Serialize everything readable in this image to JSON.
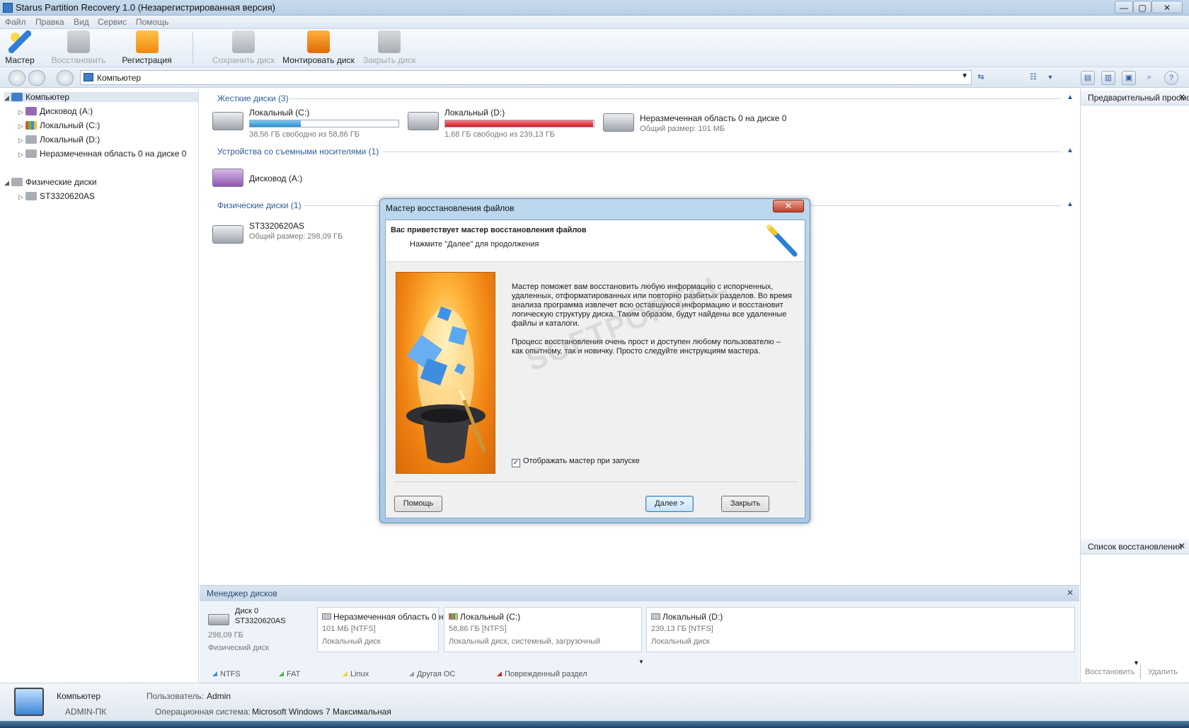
{
  "window": {
    "title": "Starus Partition Recovery 1.0 (Незарегистрированная версия)",
    "min": "—",
    "max": "▢",
    "close": "✕"
  },
  "menu": [
    "Файл",
    "Правка",
    "Вид",
    "Сервис",
    "Помощь"
  ],
  "toolbar": {
    "wizard": "Мастер",
    "restore": "Восстановить",
    "register": "Регистрация",
    "save_disk": "Сохранить диск",
    "mount_disk": "Монтировать диск",
    "close_disk": "Закрыть диск"
  },
  "address": {
    "path": "Компьютер"
  },
  "tree": {
    "computer": "Компьютер",
    "items": [
      "Дисковод (A:)",
      "Локальный (C:)",
      "Локальный (D:)",
      "Неразмеченная область 0 на диске 0"
    ],
    "physical": "Физические диски",
    "physical_items": [
      "ST3320620AS"
    ]
  },
  "main": {
    "hdd_header": "Жесткие диски (3)",
    "drive_c": {
      "name": "Локальный (C:)",
      "info": "38,56 ГБ свободно из 58,86 ГБ",
      "used": 0.345
    },
    "drive_d": {
      "name": "Локальный (D:)",
      "info": "1,68 ГБ свободно из 239,13 ГБ",
      "used": 0.993
    },
    "unalloc": {
      "name": "Неразмеченная область 0 на диске 0",
      "info": "Общий размер: 101 МБ"
    },
    "removable_header": "Устройства со съемными носителями (1)",
    "floppy": "Дисковод (A:)",
    "physical_header": "Физические диски (1)",
    "phys": {
      "name": "ST3320620AS",
      "info": "Общий размер: 298,09 ГБ"
    }
  },
  "right_panel": {
    "preview": "Предварительный просмотр",
    "restore_list": "Список восстановления",
    "restore_btn": "Восстановить",
    "delete_btn": "Удалить"
  },
  "disk_manager": {
    "title": "Менеджер дисков",
    "disk": {
      "name": "Диск 0",
      "model": "ST3320620AS",
      "size": "298,09 ГБ",
      "type": "Физический диск"
    },
    "parts": [
      {
        "name": "Неразмеченная область 0 н",
        "size": "101 МБ [NTFS]",
        "type": "Локальный диск"
      },
      {
        "name": "Локальный (C:)",
        "size": "58,86 ГБ [NTFS]",
        "type": "Локальный диск, системный, загрузочный"
      },
      {
        "name": "Локальный (D:)",
        "size": "239,13 ГБ [NTFS]",
        "type": "Локальный диск"
      }
    ],
    "legend": [
      "NTFS",
      "FAT",
      "Linux",
      "Другая ОС",
      "Поврежденный раздел"
    ]
  },
  "status": {
    "computer": "Компьютер",
    "pc_name": "ADMIN-ПК",
    "user_label": "Пользователь:",
    "user": "Admin",
    "os_label": "Операционная система:",
    "os": "Microsoft Windows 7 Максимальная"
  },
  "dialog": {
    "title": "Мастер восстановления файлов",
    "heading": "Вас приветствует мастер восстановления файлов",
    "subheading": "Нажмите \"Далее\" для продолжения",
    "para1": "Мастер поможет вам восстановить любую информацию с испорченных, удаленных, отформатированных или повторно разбитых разделов. Во время анализа программа извлечет всю оставшуюся информацию и восстановит логическую структуру диска. Таким образом, будут найдены все удаленные файлы и каталоги.",
    "para2": "Процесс восстановления очень прост и доступен любому пользователю – как опытному, так и новичку. Просто следуйте инструкциям мастера.",
    "checkbox": "Отображать мастер при запуске",
    "help": "Помощь",
    "next": "Далее >",
    "close": "Закрыть",
    "watermark": "SOFTPORTAL"
  }
}
